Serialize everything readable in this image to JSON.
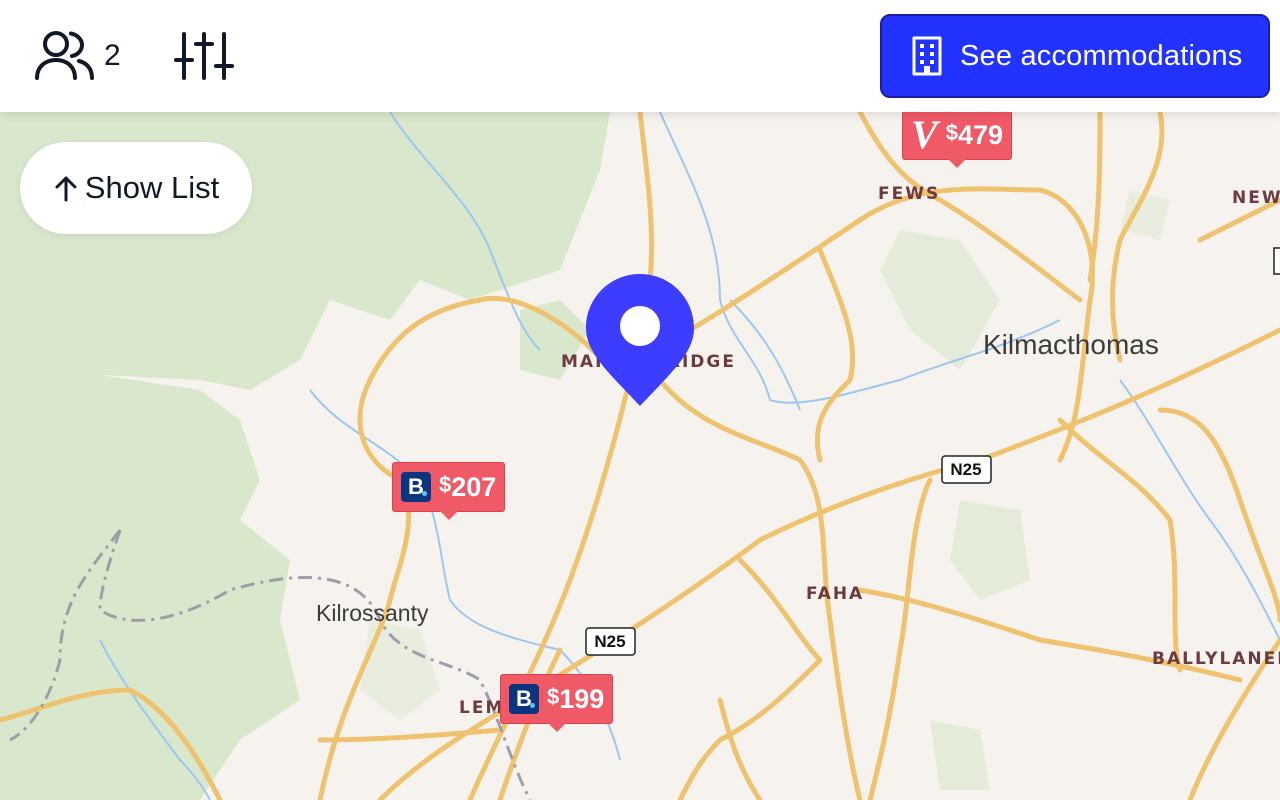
{
  "header": {
    "guests": {
      "icon": "users-icon",
      "count": "2"
    },
    "filters": {
      "icon": "sliders-icon"
    },
    "cta": {
      "icon": "building-icon",
      "label": "See accommodations"
    }
  },
  "show_list": {
    "icon": "arrow-up-icon",
    "label": "Show List"
  },
  "map": {
    "labels": {
      "mahon_bridge": "MAHON BRIDGE",
      "kilmacthomas": "Kilmacthomas",
      "kilrossanty": "Kilrossanty",
      "fews": "FEWS",
      "faha": "FAHA",
      "ballylaneen": "BALLYLANEE",
      "new": "NEW",
      "lem": "LEM"
    },
    "road_shields": [
      "N25",
      "N25"
    ],
    "markers": [
      {
        "provider": "Booking.com",
        "logo": "B",
        "currency": "$",
        "price": "207"
      },
      {
        "provider": "Booking.com",
        "logo": "B",
        "currency": "$",
        "price": "199"
      },
      {
        "provider": "Vrbo",
        "logo": "V",
        "currency": "$",
        "price": "479"
      }
    ]
  },
  "colors": {
    "accent": "#2233ff",
    "marker": "#f05a67",
    "pin": "#3d3dff",
    "booking": "#0c3580",
    "road": "#f2c76b",
    "water": "#9dc7ee",
    "forest": "#d7e6c8"
  }
}
